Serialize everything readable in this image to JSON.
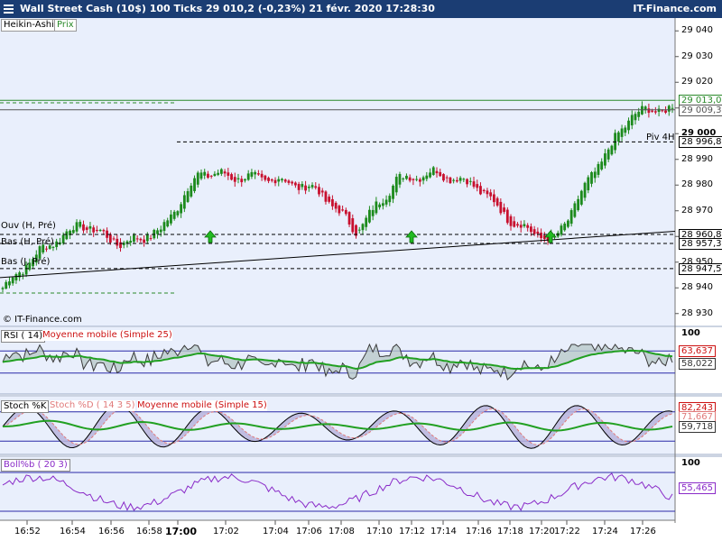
{
  "header": {
    "title": "Wall Street Cash (10$)    100 Ticks    29 010,2 (-0,23%)    21 févr. 2020 17:28:30",
    "brand": "IT-Finance.com"
  },
  "main_chart": {
    "tags": [
      "Heikin-Ashi",
      "Prix"
    ],
    "watermark": "© IT-Finance.com",
    "y_ticks": [
      "29 040",
      "29 030",
      "29 020",
      "29 010",
      "29 000",
      "28 990",
      "28 980",
      "28 970",
      "28 960",
      "28 950",
      "28 940",
      "28 930"
    ],
    "levels": [
      {
        "label": "29 013,0",
        "value": 29013.0,
        "color": "#2a8a2a",
        "style": "solid"
      },
      {
        "label": "29 009,3",
        "value": 29009.3,
        "color": "#555555",
        "style": "solid"
      },
      {
        "label": "28 996,8",
        "value": 28996.8,
        "color": "#000000",
        "style": "dashed"
      },
      {
        "label": "28 960,8",
        "value": 28960.8,
        "color": "#000000",
        "style": "dashed"
      },
      {
        "label": "28 957,3",
        "value": 28957.3,
        "color": "#000000",
        "style": "dashed"
      },
      {
        "label": "28 947,5",
        "value": 28947.5,
        "color": "#000000",
        "style": "dashed"
      }
    ],
    "left_labels": [
      "Ouv (H, Pré)",
      "Bas (H, Pré)",
      "Bas (J, Pré)"
    ],
    "right_label": "Piv 4H",
    "signals": [
      "up-arrow",
      "up-arrow",
      "up-arrow"
    ]
  },
  "rsi_panel": {
    "legend": [
      "RSI ( 14)",
      "Moyenne mobile (Simple 25)"
    ],
    "y_tick": "100",
    "values": [
      "63,637",
      "58,022"
    ]
  },
  "stoch_panel": {
    "legend": [
      "Stoch %K",
      "Stoch %D ( 14 3 5)",
      "Moyenne mobile (Simple 15)"
    ],
    "values": [
      "82,243",
      "71,667",
      "59,718"
    ]
  },
  "boll_panel": {
    "legend": "Boll%b ( 20 3)",
    "y_tick": "100",
    "value": "55,465"
  },
  "x_axis": {
    "labels": [
      "16:52",
      "16:54",
      "16:56",
      "16:58",
      "17:00",
      "17:02",
      "17:04",
      "17:06",
      "17:08",
      "17:10",
      "17:12",
      "17:14",
      "17:16",
      "17:18",
      "17:20",
      "17:22",
      "17:24",
      "17:26"
    ]
  },
  "colors": {
    "up": "#1c8a1c",
    "down": "#c8102e",
    "bg": "#e9effc",
    "rsi": "#3a3a3a",
    "ma_red": "#cc1111",
    "ma_green": "#22a022",
    "boll": "#8a2bc8",
    "header_bg": "#1b3d73"
  },
  "chart_data": {
    "type": "candlestick",
    "style": "Heikin-Ashi",
    "interval": "100 Ticks",
    "x_categories": [
      "16:52",
      "16:54",
      "16:56",
      "16:58",
      "17:00",
      "17:02",
      "17:04",
      "17:06",
      "17:08",
      "17:10",
      "17:12",
      "17:14",
      "17:16",
      "17:18",
      "17:20",
      "17:22",
      "17:24",
      "17:26"
    ],
    "ylim": [
      28925,
      29045
    ],
    "approx_close": [
      28940,
      28955,
      28965,
      28957,
      28962,
      28985,
      28983,
      28982,
      28978,
      28962,
      28982,
      28985,
      28980,
      28965,
      28958,
      28985,
      29008,
      29010
    ]
  }
}
